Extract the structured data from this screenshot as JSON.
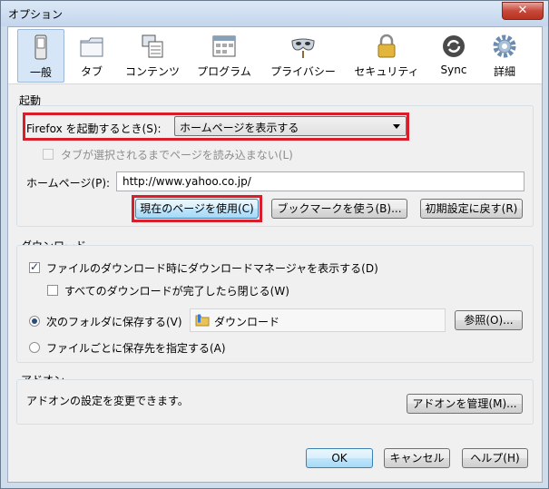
{
  "window": {
    "title": "オプション",
    "close_label": "✕"
  },
  "tabs": [
    {
      "label": "一般",
      "icon": "switch-icon",
      "selected": true
    },
    {
      "label": "タブ",
      "icon": "folder-tab-icon",
      "selected": false
    },
    {
      "label": "コンテンツ",
      "icon": "content-page-icon",
      "selected": false
    },
    {
      "label": "プログラム",
      "icon": "program-window-icon",
      "selected": false
    },
    {
      "label": "プライバシー",
      "icon": "mask-icon",
      "selected": false
    },
    {
      "label": "セキュリティ",
      "icon": "lock-icon",
      "selected": false
    },
    {
      "label": "Sync",
      "icon": "sync-arrows-icon",
      "selected": false
    },
    {
      "label": "詳細",
      "icon": "gear-icon",
      "selected": false
    }
  ],
  "startup": {
    "group_title": "起動",
    "when_label": "Firefox を起動するとき(S):",
    "when_value": "ホームページを表示する",
    "tabs_load_label": "タブが選択されるまでページを読み込まない(L)",
    "homepage_label": "ホームページ(P):",
    "homepage_value": "http://www.yahoo.co.jp/",
    "use_current_label": "現在のページを使用(C)",
    "use_bookmark_label": "ブックマークを使う(B)...",
    "restore_default_label": "初期設定に戻す(R)"
  },
  "download": {
    "group_title": "ダウンロード",
    "show_manager_label": "ファイルのダウンロード時にダウンロードマネージャを表示する(D)",
    "close_when_done_label": "すべてのダウンロードが完了したら閉じる(W)",
    "save_to_label": "次のフォルダに保存する(V)",
    "folder_value": "ダウンロード",
    "browse_label": "参照(O)...",
    "ask_label": "ファイルごとに保存先を指定する(A)"
  },
  "addons": {
    "group_title": "アドオン",
    "desc": "アドオンの設定を変更できます。",
    "manage_label": "アドオンを管理(M)..."
  },
  "footer": {
    "ok_label": "OK",
    "cancel_label": "キャンセル",
    "help_label": "ヘルプ(H)"
  },
  "colors": {
    "highlight": "#d81e2a",
    "selected_tab": "#d7e6f7"
  }
}
